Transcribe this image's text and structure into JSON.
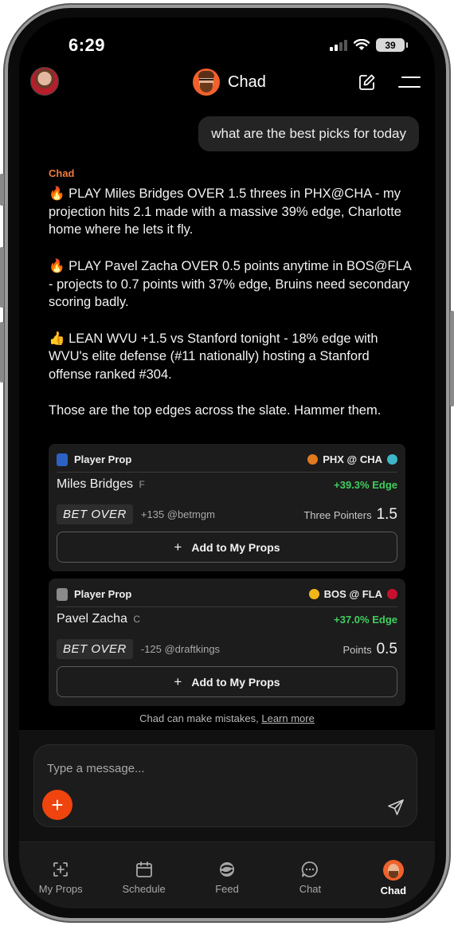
{
  "status_bar": {
    "time": "6:29",
    "battery": "39"
  },
  "header": {
    "title": "Chad"
  },
  "chat": {
    "user_message": "what are the best picks for today",
    "sender": "Chad",
    "reply_paragraphs": [
      "🔥 PLAY Miles Bridges OVER 1.5 threes in PHX@CHA - my projection hits 2.1 made with a massive 39% edge, Charlotte home where he lets it fly.",
      "🔥 PLAY Pavel Zacha OVER 0.5 points anytime in BOS@FLA - projects to 0.7 points with 37% edge, Bruins need secondary scoring badly.",
      "👍 LEAN WVU +1.5 vs Stanford tonight - 18% edge with WVU's elite defense (#11 nationally) hosting a Stanford offense ranked #304.",
      "Those are the top edges across the slate. Hammer them."
    ],
    "cards": [
      {
        "type": "Player Prop",
        "matchup": "PHX @ CHA",
        "player": "Miles Bridges",
        "position": "F",
        "edge": "+39.3% Edge",
        "bet": "BET OVER",
        "odds": "+135 @betmgm",
        "stat": "Three Pointers",
        "line": "1.5",
        "add_label": "Add to My Props",
        "colors": {
          "league": "#2b62c4",
          "away": "#e07a1f",
          "home": "#3fb6c7"
        }
      },
      {
        "type": "Player Prop",
        "matchup": "BOS @ FLA",
        "player": "Pavel Zacha",
        "position": "C",
        "edge": "+37.0% Edge",
        "bet": "BET OVER",
        "odds": "-125 @draftkings",
        "stat": "Points",
        "line": "0.5",
        "add_label": "Add to My Props",
        "colors": {
          "league": "#8a8a8a",
          "away": "#f2b619",
          "home": "#c8102e"
        }
      }
    ],
    "disclaimer": "Chad can make mistakes,",
    "learn_more": "Learn more"
  },
  "composer": {
    "placeholder": "Type a message..."
  },
  "tabs": [
    {
      "label": "My Props",
      "icon": "add-square-icon",
      "active": false
    },
    {
      "label": "Schedule",
      "icon": "calendar-icon",
      "active": false
    },
    {
      "label": "Feed",
      "icon": "feed-logo-icon",
      "active": false
    },
    {
      "label": "Chat",
      "icon": "chat-bubble-icon",
      "active": false
    },
    {
      "label": "Chad",
      "icon": "chad-avatar-icon",
      "active": true
    }
  ],
  "colors": {
    "accent": "#f0440f",
    "edge_green": "#3fcf5e",
    "sender_orange": "#f07a3c"
  }
}
